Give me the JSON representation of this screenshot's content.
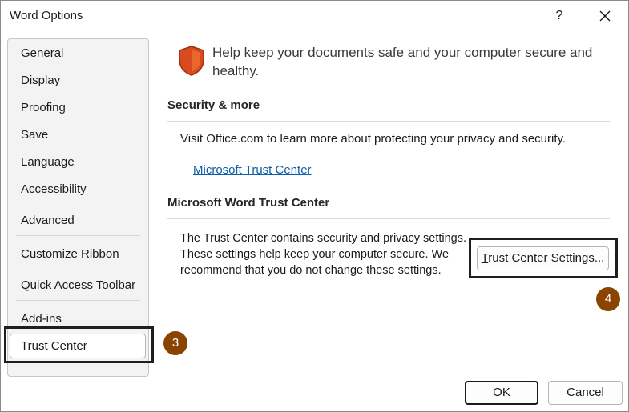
{
  "window": {
    "title": "Word Options",
    "help_label": "?"
  },
  "sidebar": {
    "items": [
      {
        "label": "General"
      },
      {
        "label": "Display"
      },
      {
        "label": "Proofing"
      },
      {
        "label": "Save"
      },
      {
        "label": "Language"
      },
      {
        "label": "Accessibility"
      },
      {
        "label": "Advanced"
      },
      {
        "label": "Customize Ribbon"
      },
      {
        "label": "Quick Access Toolbar"
      },
      {
        "label": "Add-ins"
      },
      {
        "label": "Trust Center",
        "selected": true
      }
    ]
  },
  "main": {
    "heading": "Help keep your documents safe and your computer secure and healthy.",
    "security_section": {
      "title": "Security & more",
      "text": "Visit Office.com to learn more about protecting your privacy and security.",
      "link": "Microsoft Trust Center"
    },
    "trust_center_section": {
      "title": "Microsoft Word Trust Center",
      "description": "The Trust Center contains security and privacy settings. These settings help keep your computer secure. We recommend that you do not change these settings.",
      "button_mnemonic": "T",
      "button_rest": "rust Center Settings..."
    }
  },
  "annotations": {
    "step_3": "3",
    "step_4": "4",
    "badge_color": "#8b4300"
  },
  "footer": {
    "ok_label": "OK",
    "cancel_label": "Cancel"
  },
  "icons": {
    "shield": "shield-icon",
    "close": "close-icon"
  },
  "colors": {
    "shield": "#d94b1f",
    "link": "#0f5ea8"
  }
}
